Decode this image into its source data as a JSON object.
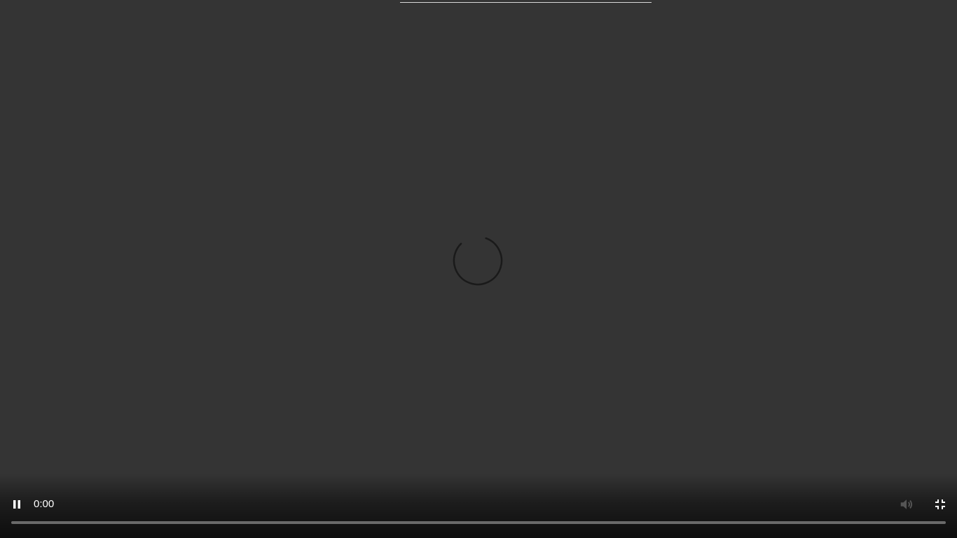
{
  "player": {
    "state": "loading",
    "current_time": "0:00",
    "progress": 0,
    "colors": {
      "background": "#343434",
      "text": "#ffffff",
      "spinner": "#1a1a1a",
      "seek_track": "#6a6a6a"
    },
    "controls": {
      "play_toggle_icon": "pause-icon",
      "volume_icon": "volume-icon",
      "fullscreen_icon": "exit-fullscreen-icon"
    }
  }
}
